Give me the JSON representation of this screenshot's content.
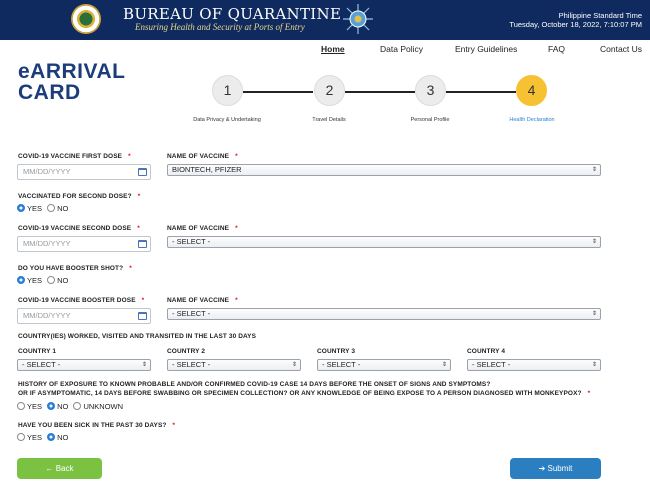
{
  "header": {
    "title": "BUREAU OF QUARANTINE",
    "subtitle": "Ensuring Health and Security at Ports of Entry",
    "time_zone": "Philippine Standard Time",
    "datetime": "Tuesday, October 18, 2022, 7:10:07 PM"
  },
  "nav": {
    "home": "Home",
    "data_policy": "Data Policy",
    "entry_guidelines": "Entry Guidelines",
    "faq": "FAQ",
    "contact": "Contact Us"
  },
  "page_title": "eARRIVAL CARD",
  "stepper": {
    "steps": [
      {
        "number": "1",
        "label": "Data Privacy & Undertaking"
      },
      {
        "number": "2",
        "label": "Travel Details"
      },
      {
        "number": "3",
        "label": "Personal Profile"
      },
      {
        "number": "4",
        "label": "Health Declaration"
      }
    ],
    "active_step": 4
  },
  "form": {
    "required_mark": "*",
    "first_dose": {
      "label": "COVID-19 VACCINE FIRST DOSE",
      "placeholder": "MM/DD/YYYY",
      "vaccine_label": "NAME OF VACCINE",
      "vaccine_value": "BIONTECH, PFIZER"
    },
    "second_dose_q": {
      "label": "VACCINATED FOR SECOND DOSE?",
      "yes": "YES",
      "no": "NO",
      "selected": "YES"
    },
    "second_dose": {
      "label": "COVID-19 VACCINE SECOND DOSE",
      "placeholder": "MM/DD/YYYY",
      "vaccine_label": "NAME OF VACCINE",
      "vaccine_value": "- SELECT -"
    },
    "booster_q": {
      "label": "DO YOU HAVE BOOSTER SHOT?",
      "yes": "YES",
      "no": "NO",
      "selected": "YES"
    },
    "booster_dose": {
      "label": "COVID-19 VACCINE BOOSTER DOSE",
      "placeholder": "MM/DD/YYYY",
      "vaccine_label": "NAME OF VACCINE",
      "vaccine_value": "- SELECT -"
    },
    "countries": {
      "label": "COUNTRY(IES) WORKED, VISITED AND TRANSITED IN THE LAST 30 DAYS",
      "items": [
        {
          "label": "COUNTRY 1",
          "value": "- SELECT -"
        },
        {
          "label": "COUNTRY 2",
          "value": "- SELECT -"
        },
        {
          "label": "COUNTRY 3",
          "value": "- SELECT -"
        },
        {
          "label": "COUNTRY 4",
          "value": "- SELECT -"
        }
      ]
    },
    "exposure": {
      "line1": "HISTORY OF EXPOSURE TO KNOWN PROBABLE AND/OR CONFIRMED COVID-19 CASE 14 DAYS BEFORE THE ONSET OF SIGNS AND SYMPTOMS?",
      "line2": "OR IF ASYMPTOMATIC, 14 DAYS BEFORE SWABBING OR SPECIMEN COLLECTION? OR ANY KNOWLEDGE OF BEING EXPOSE TO A PERSON DIAGNOSED WITH MONKEYPOX?",
      "yes": "YES",
      "no": "NO",
      "unknown": "UNKNOWN",
      "selected": "NO"
    },
    "sick": {
      "label": "HAVE YOU BEEN SICK IN THE PAST 30 DAYS?",
      "yes": "YES",
      "no": "NO",
      "selected": "NO"
    }
  },
  "buttons": {
    "back": "← Back",
    "submit": "➔ Submit"
  },
  "colors": {
    "header_bg": "#0f2a5f",
    "active_step": "#f6c233",
    "back_button": "#7cc242",
    "submit_button": "#2b7fc1",
    "radio_selected": "#2a7fd6"
  }
}
